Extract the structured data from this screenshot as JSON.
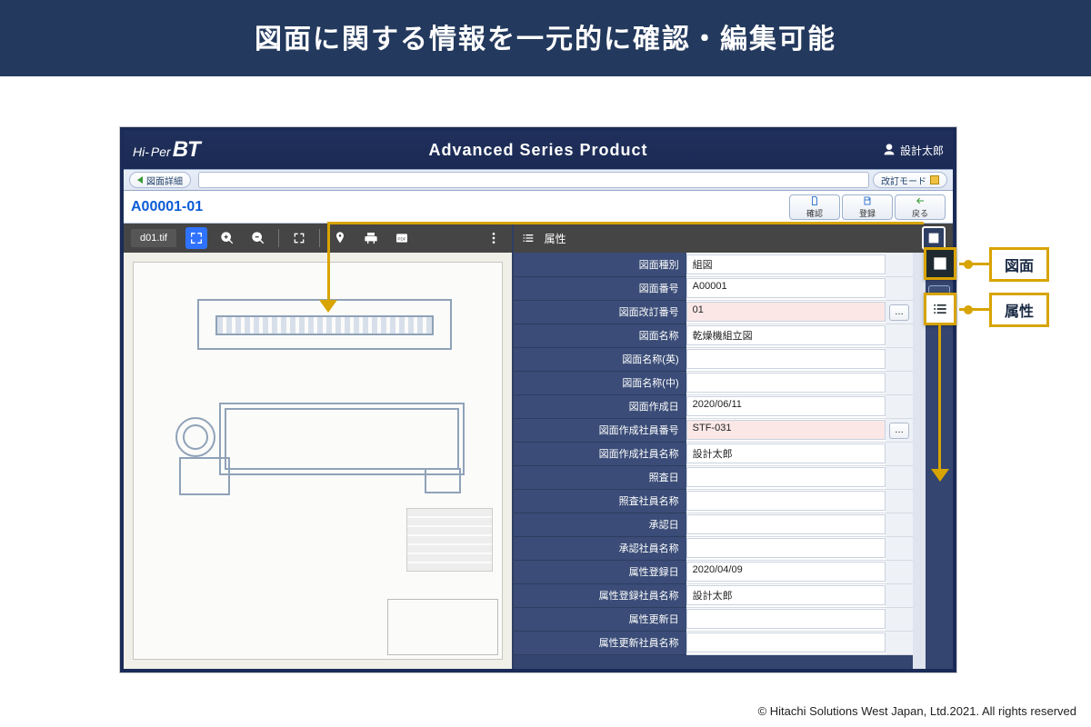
{
  "banner": "図面に関する情報を一元的に確認・編集可能",
  "logo": {
    "hi": "Hi-",
    "per": "Per",
    "bt": "BT"
  },
  "product_title": "Advanced Series Product",
  "user_name": "設計太郎",
  "subtoolbar": {
    "left_label": "図面詳細",
    "right_label": "改訂モード"
  },
  "doc_id": "A00001-01",
  "actions": {
    "confirm": "確認",
    "register": "登録",
    "back": "戻る"
  },
  "viewer": {
    "file_name": "d01.tif"
  },
  "attr_header": "属性",
  "attributes": [
    {
      "label": "図面種別",
      "value": "組図",
      "pink": false,
      "dots": false
    },
    {
      "label": "図面番号",
      "value": "A00001",
      "pink": false,
      "dots": false
    },
    {
      "label": "図面改訂番号",
      "value": "01",
      "pink": true,
      "dots": true
    },
    {
      "label": "図面名称",
      "value": "乾燥機組立図",
      "pink": false,
      "dots": false
    },
    {
      "label": "図面名称(英)",
      "value": "",
      "pink": false,
      "dots": false
    },
    {
      "label": "図面名称(中)",
      "value": "",
      "pink": false,
      "dots": false
    },
    {
      "label": "図面作成日",
      "value": "2020/06/11",
      "pink": false,
      "dots": false
    },
    {
      "label": "図面作成社員番号",
      "value": "STF-031",
      "pink": true,
      "dots": true
    },
    {
      "label": "図面作成社員名称",
      "value": "設計太郎",
      "pink": false,
      "dots": false
    },
    {
      "label": "照査日",
      "value": "",
      "pink": false,
      "dots": false
    },
    {
      "label": "照査社員名称",
      "value": "",
      "pink": false,
      "dots": false
    },
    {
      "label": "承認日",
      "value": "",
      "pink": false,
      "dots": false
    },
    {
      "label": "承認社員名称",
      "value": "",
      "pink": false,
      "dots": false
    },
    {
      "label": "属性登録日",
      "value": "2020/04/09",
      "pink": false,
      "dots": false
    },
    {
      "label": "属性登録社員名称",
      "value": "設計太郎",
      "pink": false,
      "dots": false
    },
    {
      "label": "属性更新日",
      "value": "",
      "pink": false,
      "dots": false
    },
    {
      "label": "属性更新社員名称",
      "value": "",
      "pink": false,
      "dots": false
    }
  ],
  "callouts": {
    "drawing_label": "図面",
    "attr_label": "属性"
  },
  "copyright": "© Hitachi Solutions West Japan, Ltd.2021. All rights reserved"
}
